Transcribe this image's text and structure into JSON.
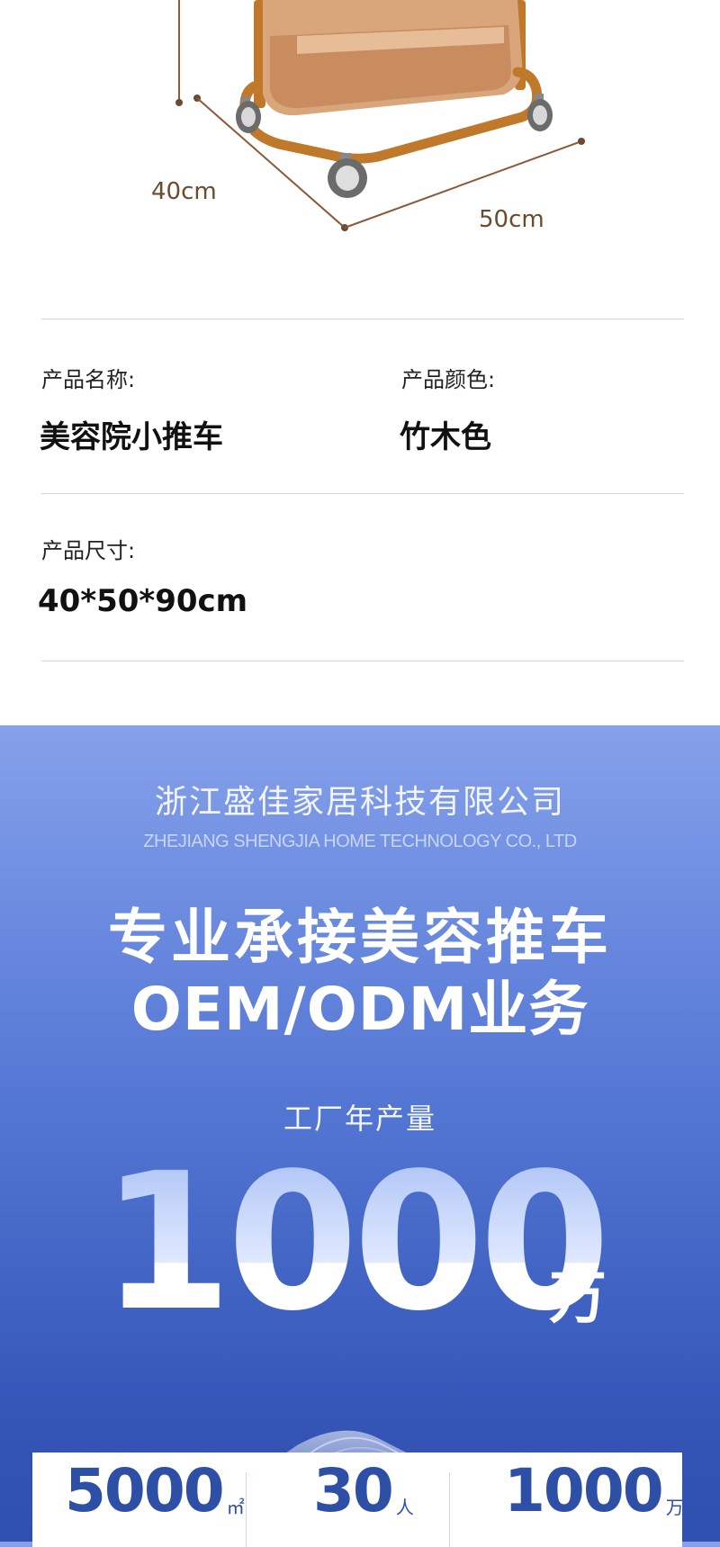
{
  "dimensions": {
    "depth": "40cm",
    "width": "50cm"
  },
  "specs": {
    "name_label": "产品名称:",
    "name_value": "美容院小推车",
    "color_label": "产品颜色:",
    "color_value": "竹木色",
    "size_label": "产品尺寸:",
    "size_value": "40*50*90cm"
  },
  "banner": {
    "company_cn": "浙江盛佳家居科技有限公司",
    "company_en": "ZHEJIANG SHENGJIA HOME TECHNOLOGY CO., LTD",
    "headline_1": "专业承接美容推车",
    "headline_2": "OEM/ODM业务",
    "capacity_label": "工厂年产量",
    "capacity_value": "1000",
    "capacity_unit": "万"
  },
  "stats": [
    {
      "value": "5000",
      "unit": "㎡"
    },
    {
      "value": "30",
      "unit": "人"
    },
    {
      "value": "1000",
      "unit": "万"
    }
  ],
  "colors": {
    "banner_top": "#86a1ea",
    "banner_bottom": "#3050b0",
    "stat_text": "#2e4fa6",
    "dimension_text": "#6b4a2e",
    "cart_frame": "#c0782a",
    "cart_wood": "#d9a57a"
  }
}
